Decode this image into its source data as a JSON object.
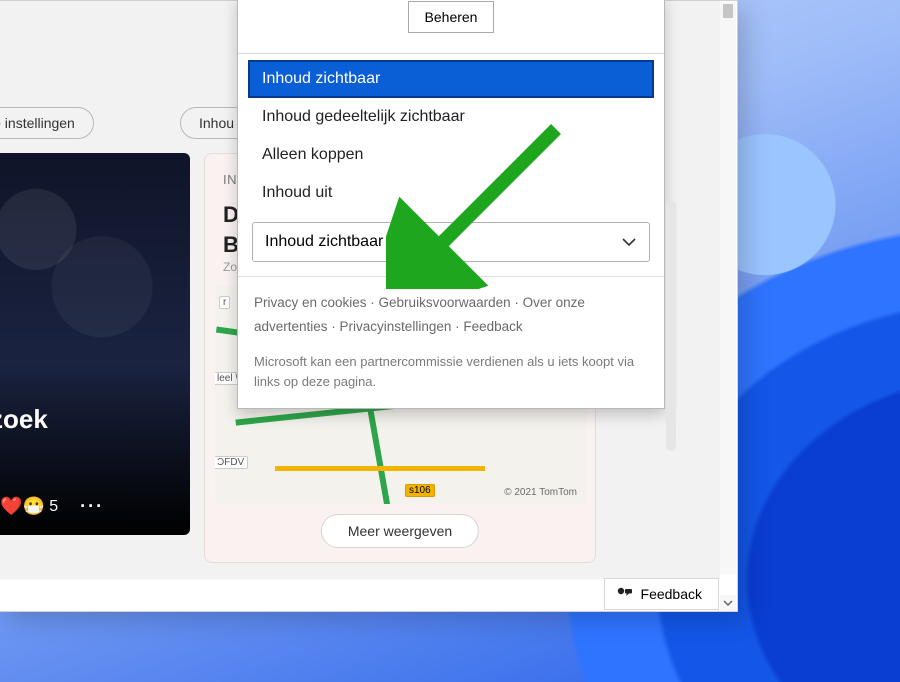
{
  "chips": {
    "left": "nlijke instellingen",
    "right": "Inhou"
  },
  "leftCard": {
    "title": "zoek",
    "reactions": "😠❤️😷",
    "count": "5",
    "more": "···"
  },
  "rightCard": {
    "tag": "INCI",
    "line1": "De",
    "line2": "Bilc",
    "byline": "Zojui",
    "label_r": "r",
    "label_deel": "leel \\\\",
    "label_ofdv": "ƆFDV",
    "label_s106": "s106",
    "mapCredit": "© 2021 TomTom",
    "moreBtn": "Meer weergeven"
  },
  "popover": {
    "beheren": "Beheren",
    "options": [
      "Inhoud zichtbaar",
      "Inhoud gedeeltelijk zichtbaar",
      "Alleen koppen",
      "Inhoud uit"
    ],
    "selected": "Inhoud zichtbaar",
    "footerLinks": "Privacy en cookies · Gebruiksvoorwaarden · Over onze advertenties · Privacyinstellingen · Feedback",
    "footerNote": "Microsoft kan een partnercommissie verdienen als u iets koopt via links op deze pagina."
  },
  "feedback": "Feedback"
}
